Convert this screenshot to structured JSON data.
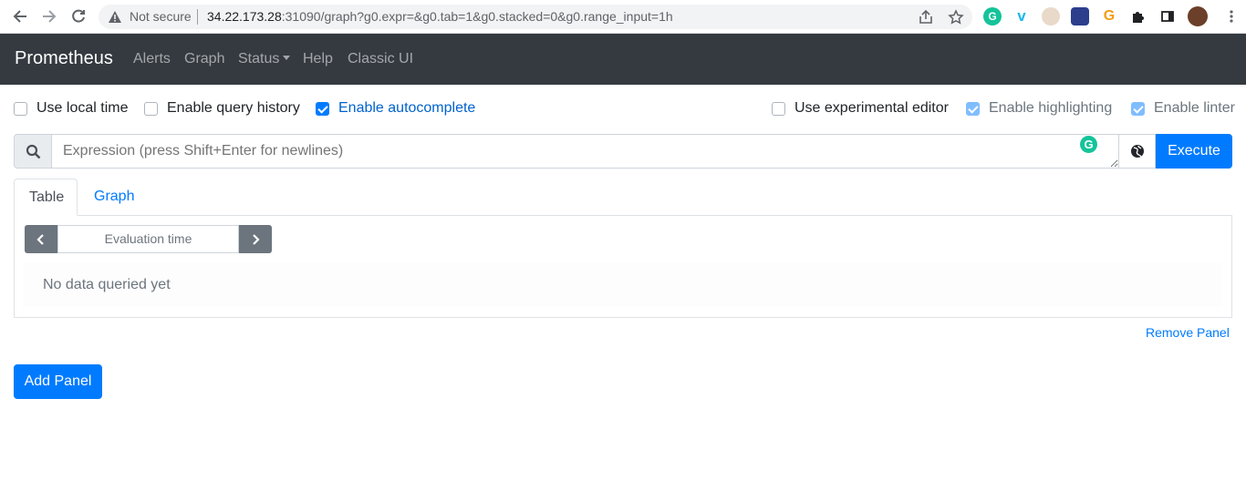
{
  "browser": {
    "security_label": "Not secure",
    "url_host": "34.22.173.28",
    "url_rest": ":31090/graph?g0.expr=&g0.tab=1&g0.stacked=0&g0.range_input=1h",
    "extensions": [
      "grammarly-icon",
      "vimeo-icon",
      "face-extension-icon",
      "puzzle-game-icon",
      "orange-g-icon",
      "extensions-puzzle-icon",
      "sidebar-icon",
      "profile-avatar"
    ]
  },
  "navbar": {
    "brand": "Prometheus",
    "links": [
      "Alerts",
      "Graph",
      "Status",
      "Help",
      "Classic UI"
    ]
  },
  "options": {
    "use_local_time": {
      "label": "Use local time",
      "checked": false
    },
    "enable_query_history": {
      "label": "Enable query history",
      "checked": false
    },
    "enable_autocomplete": {
      "label": "Enable autocomplete",
      "checked": true
    },
    "use_experimental_editor": {
      "label": "Use experimental editor",
      "checked": false
    },
    "enable_highlighting": {
      "label": "Enable highlighting",
      "checked": true
    },
    "enable_linter": {
      "label": "Enable linter",
      "checked": true
    }
  },
  "expression": {
    "placeholder": "Expression (press Shift+Enter for newlines)",
    "execute_label": "Execute"
  },
  "panel": {
    "tabs": [
      "Table",
      "Graph"
    ],
    "active_tab": "Table",
    "evaluation_time_placeholder": "Evaluation time",
    "empty_message": "No data queried yet",
    "remove_label": "Remove Panel"
  },
  "add_panel_label": "Add Panel",
  "colors": {
    "navbar_bg": "#343a40",
    "primary": "#007bff"
  }
}
